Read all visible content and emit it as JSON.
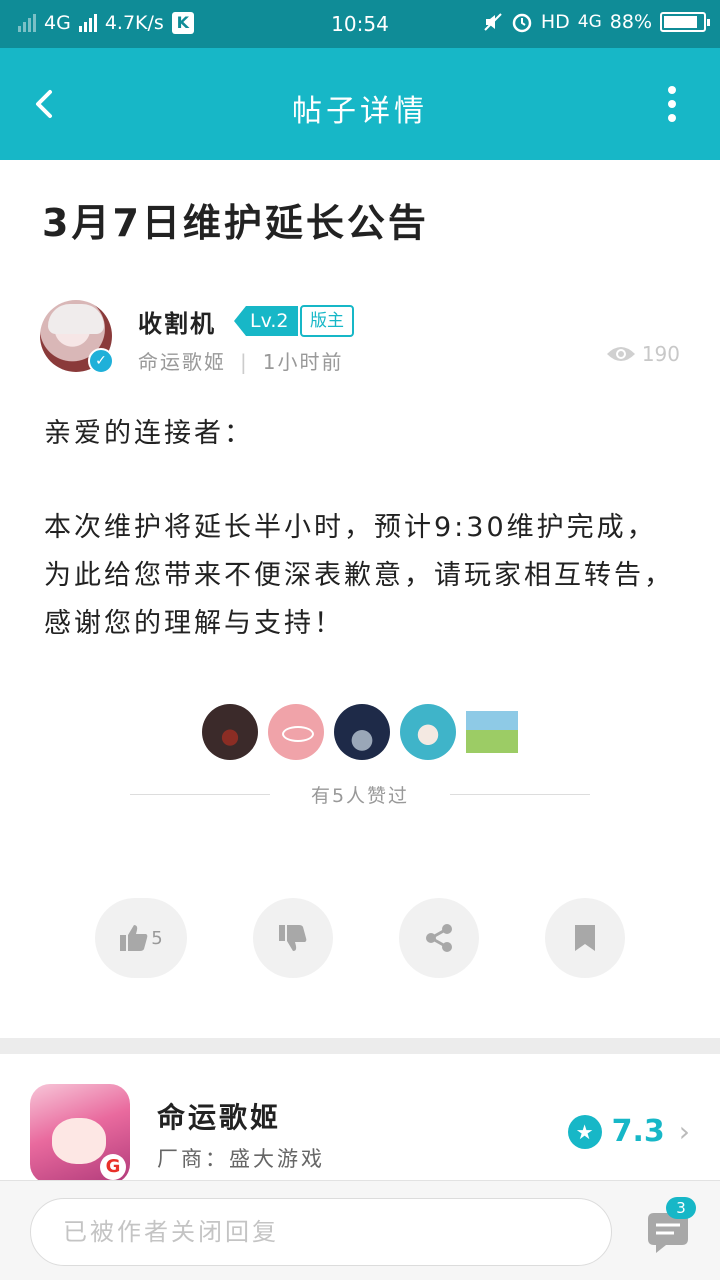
{
  "status_bar": {
    "network": "4G",
    "speed": "4.7K/s",
    "k_badge": "K",
    "time": "10:54",
    "hd": "HD",
    "net2": "4G",
    "battery": "88%",
    "battery_level": 0.88
  },
  "appbar": {
    "title": "帖子详情",
    "back_icon": "back-arrow-icon",
    "more_icon": "more-vertical-icon"
  },
  "post": {
    "title": "3月7日维护延长公告",
    "author": {
      "name": "收割机",
      "level": "Lv.2",
      "role": "版主",
      "forum": "命运歌姬",
      "time": "1小时前"
    },
    "views": "190",
    "greeting": "亲爱的连接者：",
    "paragraph": "本次维护将延长半小时，预计9:30维护完成，为此给您带来不便深表歉意，请玩家相互转告，感谢您的理解与支持！"
  },
  "likes": {
    "summary": "有5人赞过",
    "like_count": "5"
  },
  "game": {
    "name": "命运歌姬",
    "vendor": "厂商：盛大游戏",
    "rating": "7.3",
    "icon_badge": "G"
  },
  "reply": {
    "placeholder": "已被作者关闭回复",
    "comment_count": "3"
  },
  "colors": {
    "accent": "#17b7c7",
    "status_bar": "#0f8c97"
  }
}
